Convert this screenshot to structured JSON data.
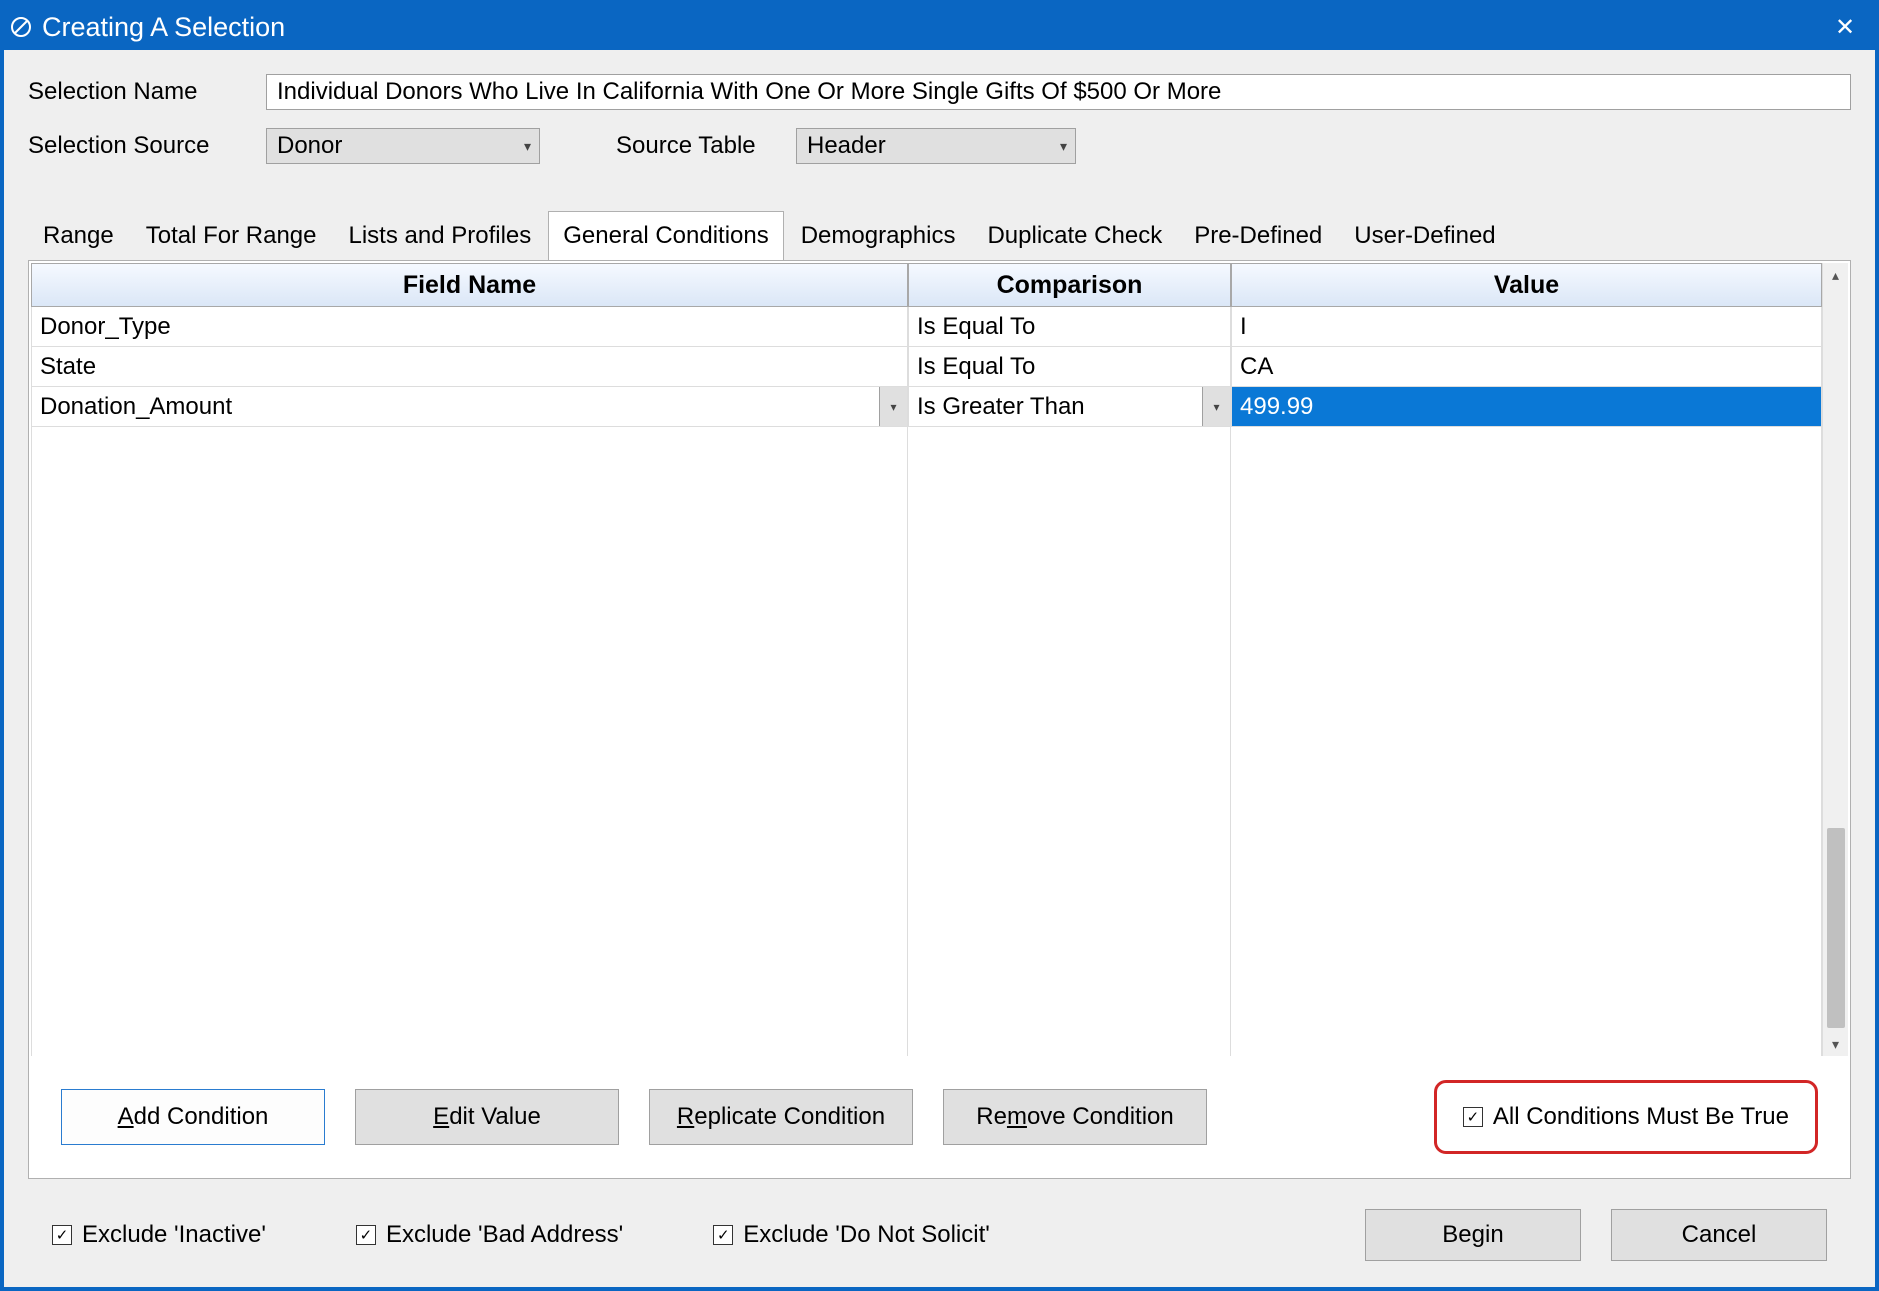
{
  "title": "Creating A Selection",
  "form": {
    "name_label": "Selection Name",
    "name_value": "Individual Donors Who Live In California With One Or More Single Gifts Of $500 Or More",
    "source_label": "Selection Source",
    "source_value": "Donor",
    "source_table_label": "Source Table",
    "source_table_value": "Header"
  },
  "tabs": [
    {
      "label": "Range"
    },
    {
      "label": "Total For Range"
    },
    {
      "label": "Lists and Profiles"
    },
    {
      "label": "General Conditions"
    },
    {
      "label": "Demographics"
    },
    {
      "label": "Duplicate Check"
    },
    {
      "label": "Pre-Defined"
    },
    {
      "label": "User-Defined"
    }
  ],
  "active_tab": 3,
  "columns": {
    "field_name": "Field Name",
    "comparison": "Comparison",
    "value": "Value"
  },
  "rows": [
    {
      "field": "Donor_Type",
      "comparison": "Is Equal To",
      "value": "I",
      "selected": false
    },
    {
      "field": "State",
      "comparison": "Is Equal To",
      "value": "CA",
      "selected": false
    },
    {
      "field": "Donation_Amount",
      "comparison": "Is Greater Than",
      "value": "499.99",
      "selected": true
    }
  ],
  "buttons": {
    "add": "Add Condition",
    "edit": "Edit Value",
    "replicate": "Replicate Condition",
    "remove": "Remove Condition",
    "all_true": "All Conditions Must Be True",
    "begin": "Begin",
    "cancel": "Cancel"
  },
  "footer_checks": {
    "inactive": "Exclude 'Inactive'",
    "bad_address": "Exclude 'Bad Address'",
    "no_solicit": "Exclude 'Do Not Solicit'"
  },
  "checkmark": "✓"
}
